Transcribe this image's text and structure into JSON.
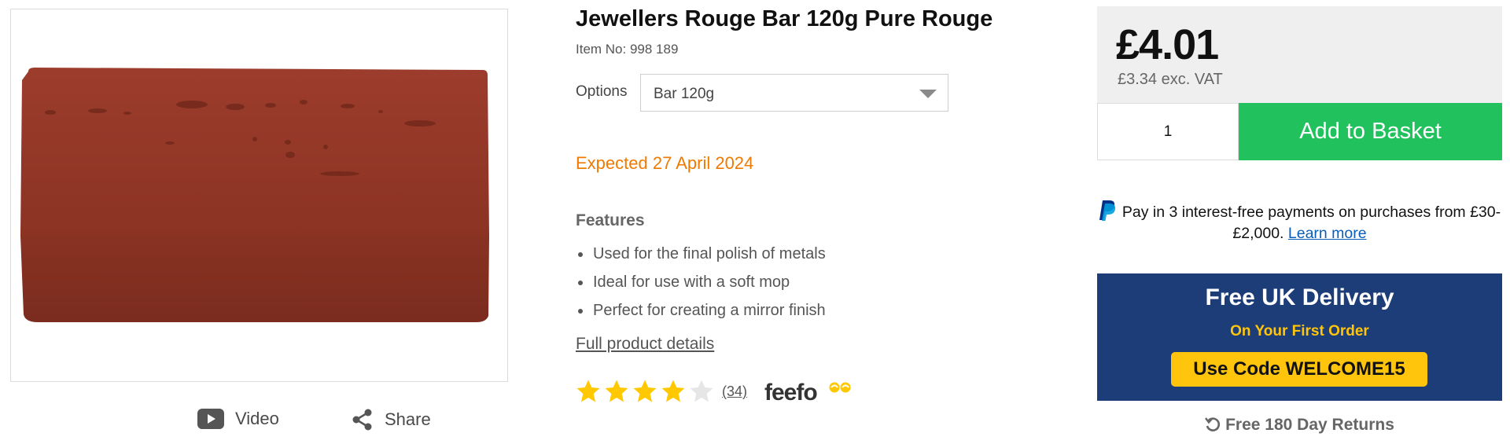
{
  "product": {
    "title": "Jewellers Rouge Bar 120g Pure Rouge",
    "item_no": "Item No: 998 189",
    "image_alt": "rouge-bar-image"
  },
  "media": {
    "video_label": "Video",
    "share_label": "Share"
  },
  "options": {
    "label": "Options",
    "selected": "Bar 120g"
  },
  "availability": {
    "expected": "Expected 27 April 2024"
  },
  "features": {
    "title": "Features",
    "items": [
      "Used for the final polish of metals",
      "Ideal for use with a soft mop",
      "Perfect for creating a mirror finish"
    ],
    "full_details_label": "Full product details"
  },
  "rating": {
    "stars": 4,
    "max_stars": 5,
    "review_count": "(34)",
    "provider": "feefo"
  },
  "pricing": {
    "price": "£4.01",
    "price_ex_vat": "£3.34 exc. VAT",
    "quantity": "1",
    "add_to_basket_label": "Add to Basket"
  },
  "paypal": {
    "text": "Pay in 3 interest-free payments on purchases from £30-£2,000.",
    "link": "Learn more"
  },
  "promo": {
    "title": "Free UK Delivery",
    "subtitle": "On Your First Order",
    "code": "Use Code WELCOME15"
  },
  "returns": {
    "label": "Free 180 Day Returns"
  },
  "colors": {
    "basket_green": "#21c25e",
    "promo_navy": "#1c3d78",
    "promo_yellow": "#ffc40c",
    "expected_orange": "#f07a00",
    "star_yellow": "#ffc800"
  }
}
